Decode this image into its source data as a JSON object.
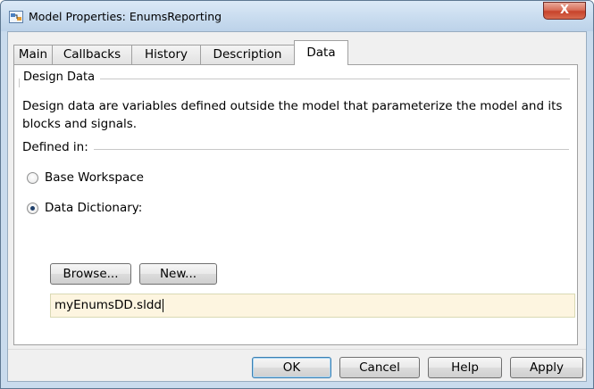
{
  "window": {
    "title": "Model Properties: EnumsReporting",
    "close_label": "X"
  },
  "tabs": [
    {
      "label": "Main",
      "active": false
    },
    {
      "label": "Callbacks",
      "active": false
    },
    {
      "label": "History",
      "active": false
    },
    {
      "label": "Description",
      "active": false
    },
    {
      "label": "Data",
      "active": true
    }
  ],
  "design_data": {
    "group_label": "Design Data",
    "description": "Design data are variables defined outside the model that parameterize the model and its blocks and signals.",
    "defined_in_label": "Defined in:",
    "options": [
      {
        "label": "Base Workspace",
        "selected": false
      },
      {
        "label": "Data Dictionary:",
        "selected": true
      }
    ],
    "browse_label": "Browse...",
    "new_label": "New...",
    "dictionary_file": "myEnumsDD.sldd"
  },
  "footer": {
    "ok_label": "OK",
    "cancel_label": "Cancel",
    "help_label": "Help",
    "apply_label": "Apply"
  },
  "colors": {
    "titlebar": "#c9dbed",
    "close_button": "#c7432b",
    "input_background": "#fdf5e0"
  }
}
